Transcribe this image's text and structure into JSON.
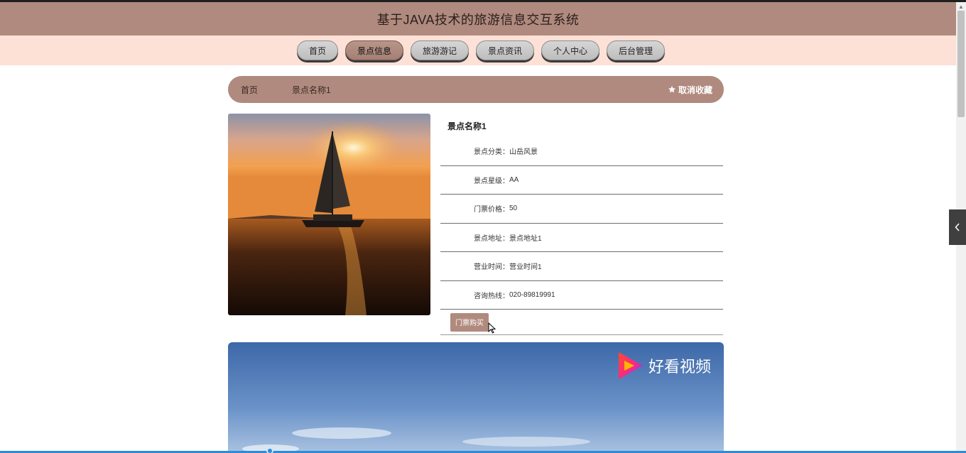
{
  "header": {
    "title": "基于JAVA技术的旅游信息交互系统"
  },
  "nav": {
    "items": [
      {
        "label": "首页"
      },
      {
        "label": "景点信息"
      },
      {
        "label": "旅游游记"
      },
      {
        "label": "景点资讯"
      },
      {
        "label": "个人中心"
      },
      {
        "label": "后台管理"
      }
    ],
    "active_index": 1
  },
  "breadcrumb": {
    "home": "首页",
    "current": "景点名称1",
    "favorite_label": "取消收藏"
  },
  "detail": {
    "name": "景点名称1",
    "fields": [
      {
        "label": "景点分类：",
        "value": "山岳风景"
      },
      {
        "label": "景点星级：",
        "value": "AA"
      },
      {
        "label": "门票价格：",
        "value": "50"
      },
      {
        "label": "景点地址：",
        "value": "景点地址1"
      },
      {
        "label": "营业时间：",
        "value": "营业时间1"
      },
      {
        "label": "咨询热线：",
        "value": "020-89819991"
      }
    ],
    "buy_label": "门票购买"
  },
  "video": {
    "watermark": "好看视频"
  },
  "colors": {
    "accent": "#b08a7e",
    "nav_bg": "#fde0d6"
  },
  "icons": {
    "favorite": "star-icon",
    "side_toggle": "chevron-left-icon"
  }
}
